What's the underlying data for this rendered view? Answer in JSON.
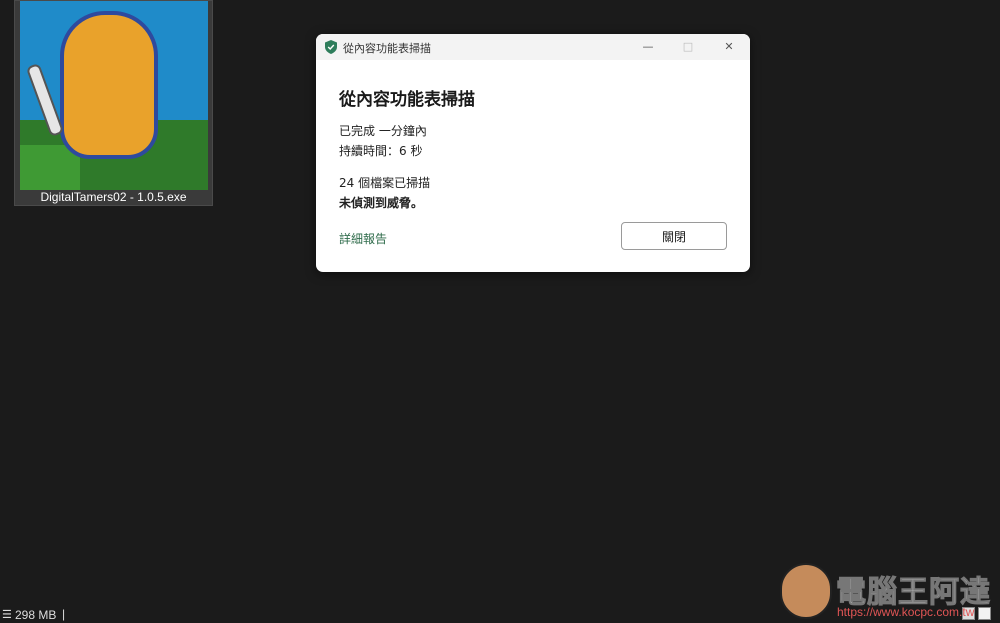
{
  "desktop": {
    "file": {
      "name": "DigitalTamers02 - 1.0.5.exe",
      "icon": "game-thumbnail-icon"
    }
  },
  "dialog": {
    "window_title": "從內容功能表掃描",
    "window_controls": {
      "minimize": "—",
      "maximize": "□",
      "close": "✕"
    },
    "heading": "從內容功能表掃描",
    "completed": "已完成 一分鐘內",
    "duration": "持續時間：6 秒",
    "files_scanned": "24 個檔案已掃描",
    "threats": "未偵測到威脅。",
    "details_link": "詳細報告",
    "close_button": "關閉",
    "accent_color": "#2e6b4a",
    "icon": "shield-check-icon"
  },
  "statusbar": {
    "memory": "298 MB",
    "separator": "|",
    "icon": "list-icon"
  },
  "watermark": {
    "title": "電腦王阿達",
    "url": "https://www.kocpc.com.tw"
  }
}
